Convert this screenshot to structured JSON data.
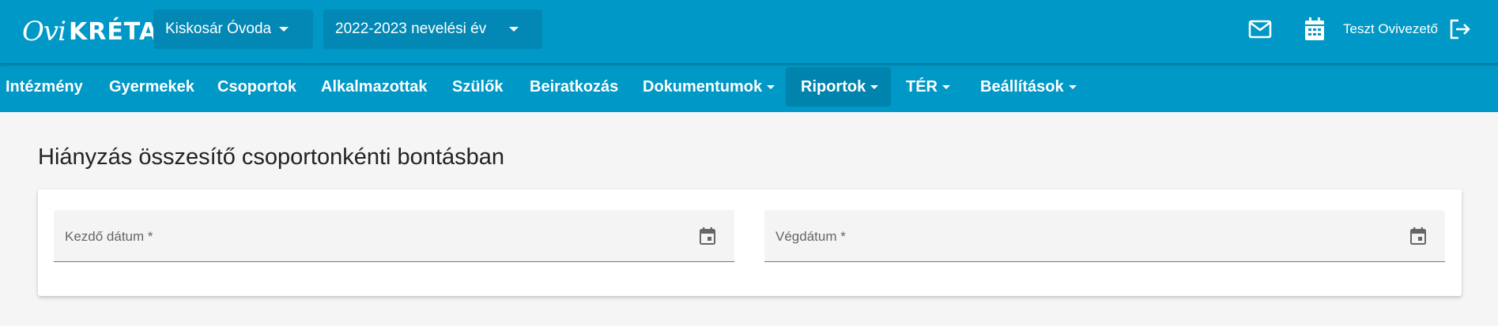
{
  "app": {
    "logo_text_a": "Ovi",
    "logo_text_b": "KRÉTA",
    "institution_selector": "Kiskosár Óvoda",
    "year_selector": "2022-2023 nevelési év",
    "user_name": "Teszt Ovivezető",
    "icons": {
      "mail": "mail-icon",
      "calendar": "calendar-icon",
      "logout": "logout-icon"
    }
  },
  "nav": {
    "items": [
      {
        "label": "Intézmény",
        "dropdown": false,
        "active": false
      },
      {
        "label": "Gyermekek",
        "dropdown": false,
        "active": false
      },
      {
        "label": "Csoportok",
        "dropdown": false,
        "active": false
      },
      {
        "label": "Alkalmazottak",
        "dropdown": false,
        "active": false
      },
      {
        "label": "Szülők",
        "dropdown": false,
        "active": false
      },
      {
        "label": "Beiratkozás",
        "dropdown": false,
        "active": false
      },
      {
        "label": "Dokumentumok",
        "dropdown": true,
        "active": false
      },
      {
        "label": "Riportok",
        "dropdown": true,
        "active": true
      },
      {
        "label": "TÉR",
        "dropdown": true,
        "active": false
      },
      {
        "label": "Beállítások",
        "dropdown": true,
        "active": false
      }
    ]
  },
  "main": {
    "title": "Hiányzás összesítő csoportonkénti bontásban",
    "start_date_label": "Kezdő dátum *",
    "end_date_label": "Végdátum *"
  },
  "colors": {
    "primary": "#0098c6",
    "active_nav": "#0083ad",
    "selector_bg": "#0388b5",
    "page_bg": "#f5f5f5"
  }
}
